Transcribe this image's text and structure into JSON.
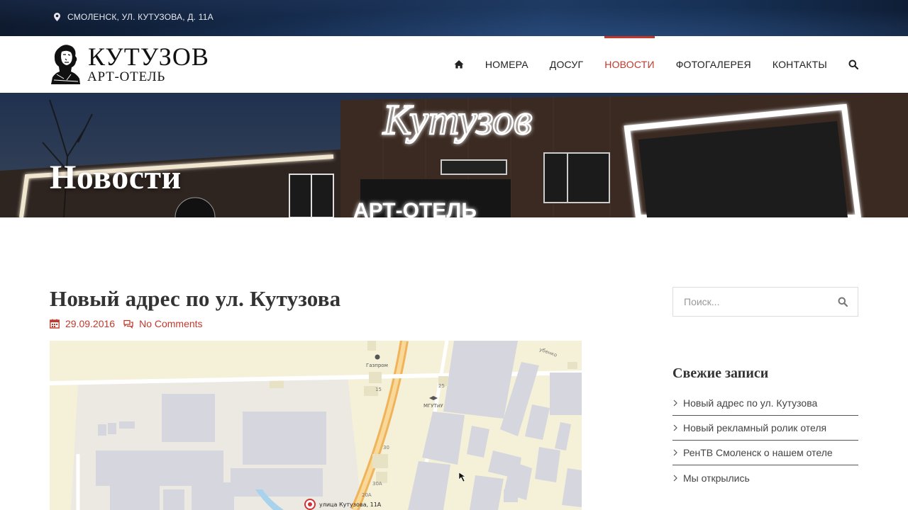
{
  "topbar": {
    "address": "СМОЛЕНСК, УЛ. КУТУЗОВА, Д. 11А"
  },
  "logo": {
    "title": "КУТУЗОВ",
    "subtitle": "АРТ-ОТЕЛЬ"
  },
  "nav": {
    "items": [
      {
        "label": "НОМЕРА"
      },
      {
        "label": "ДОСУГ"
      },
      {
        "label": "НОВОСТИ",
        "active": true
      },
      {
        "label": "ФОТОГАЛЕРЕЯ"
      },
      {
        "label": "КОНТАКТЫ"
      }
    ]
  },
  "banner": {
    "page_title": "Новости",
    "sign_script": "Кутузов",
    "sign_block": "АРТ-ОТЕЛЬ"
  },
  "post": {
    "title": "Новый адрес по ул. Кутузова",
    "date": "29.09.2016",
    "comments": "No Comments",
    "map": {
      "labels": {
        "gazprom": "Газпром",
        "mgutu": "МГУТиУ",
        "n15": "15",
        "n25": "25",
        "n30": "30",
        "n30a": "30А",
        "n20a": "20А",
        "street": "улица Кутузова, 11А",
        "corner": "убенко"
      }
    }
  },
  "sidebar": {
    "search_placeholder": "Поиск...",
    "recent_title": "Свежие записи",
    "recent": [
      {
        "label": "Новый адрес по ул. Кутузова"
      },
      {
        "label": "Новый рекламный ролик отеля"
      },
      {
        "label": "РенТВ Смоленск о нашем отеле"
      },
      {
        "label": "Мы открылись"
      }
    ]
  },
  "colors": {
    "accent": "#c0392b",
    "topbar": "#13294a"
  }
}
